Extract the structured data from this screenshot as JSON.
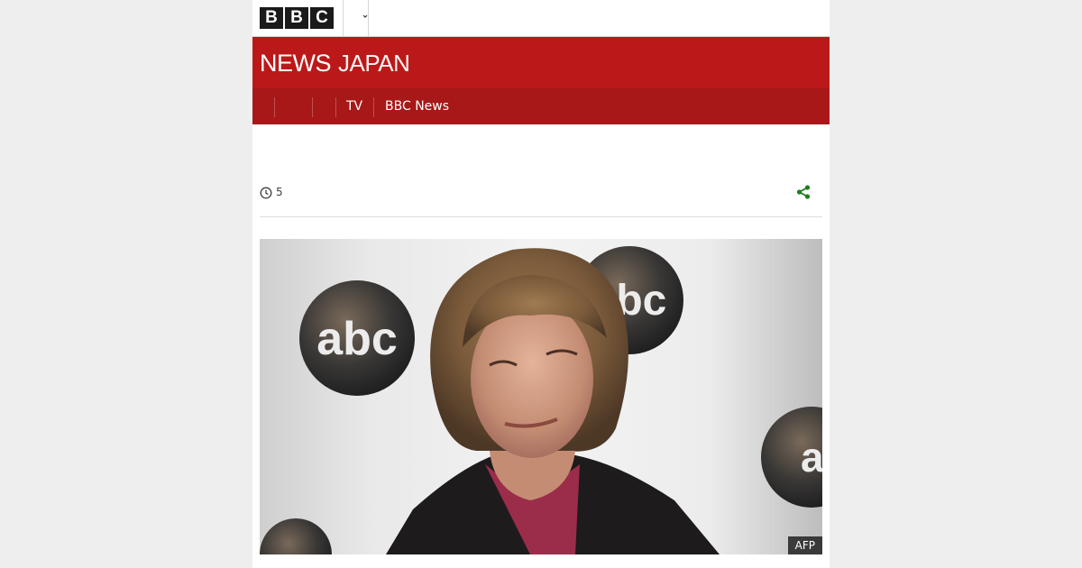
{
  "header": {
    "bbc_letters": [
      "B",
      "B",
      "C"
    ],
    "brand_primary": "NEWS",
    "brand_secondary": "JAPAN"
  },
  "nav": {
    "items": [
      {
        "label": ""
      },
      {
        "label": ""
      },
      {
        "label": "TV"
      },
      {
        "label": "BBC News"
      }
    ]
  },
  "article": {
    "reading_count": "5",
    "image_credit": "AFP"
  },
  "icons": {
    "clock": "clock-icon",
    "share": "share-icon",
    "caret": "chevron-down-icon"
  },
  "colors": {
    "brand_red": "#bb1919",
    "nav_red": "#a81818",
    "share_green": "#1b7e1b"
  }
}
